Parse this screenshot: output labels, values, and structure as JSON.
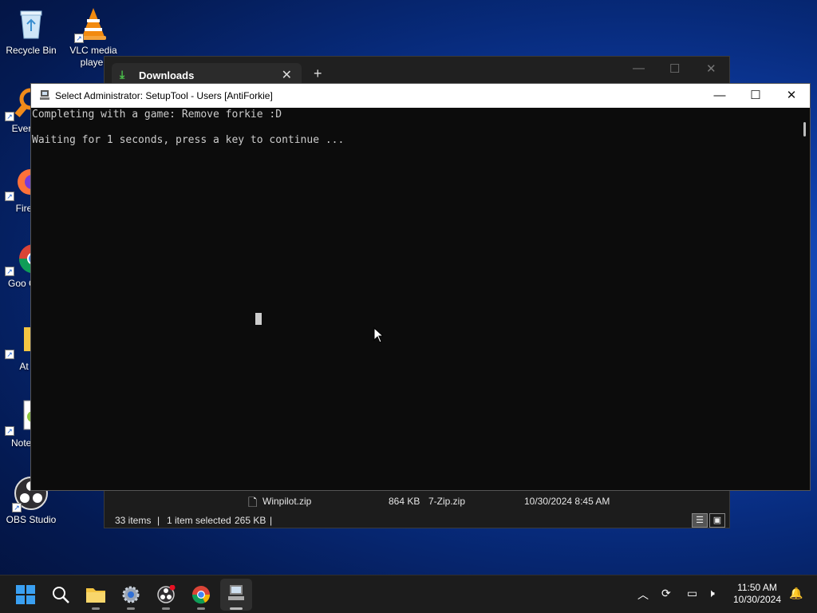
{
  "desktop": {
    "icons": [
      {
        "name": "desktop-icon-recycle-bin",
        "label": "Recycle Bin"
      },
      {
        "name": "desktop-icon-vlc",
        "label": "VLC media player"
      },
      {
        "name": "desktop-icon-everything",
        "label": "Every"
      },
      {
        "name": "desktop-icon-firefox",
        "label": "Fire"
      },
      {
        "name": "desktop-icon-chrome",
        "label": "Goo Chro"
      },
      {
        "name": "desktop-icon-at",
        "label": "At"
      },
      {
        "name": "desktop-icon-notepad",
        "label": "Notep"
      },
      {
        "name": "desktop-icon-obs",
        "label": "OBS Studio"
      }
    ]
  },
  "explorer": {
    "tab_title": "Downloads",
    "file_row": {
      "name": "Winpilot.zip",
      "size": "864 KB",
      "type": "7-Zip.zip",
      "date": "10/30/2024 8:45 AM"
    },
    "status": {
      "items": "33 items",
      "selected": "1 item selected",
      "size": "265 KB"
    }
  },
  "console": {
    "title": "Select Administrator:  SetupTool - Users [AntiForkie]",
    "lines": [
      "Completing with a game: Remove forkie :D",
      "Waiting for 1 seconds, press a key to continue ..."
    ]
  },
  "taskbar": {
    "clock_time": "11:50 AM",
    "clock_date": "10/30/2024"
  },
  "colors": {
    "console_bg": "#0c0c0c",
    "console_text": "#cccccc",
    "taskbar_bg": "#1c1c1c",
    "accent": "#1a5fd0"
  }
}
